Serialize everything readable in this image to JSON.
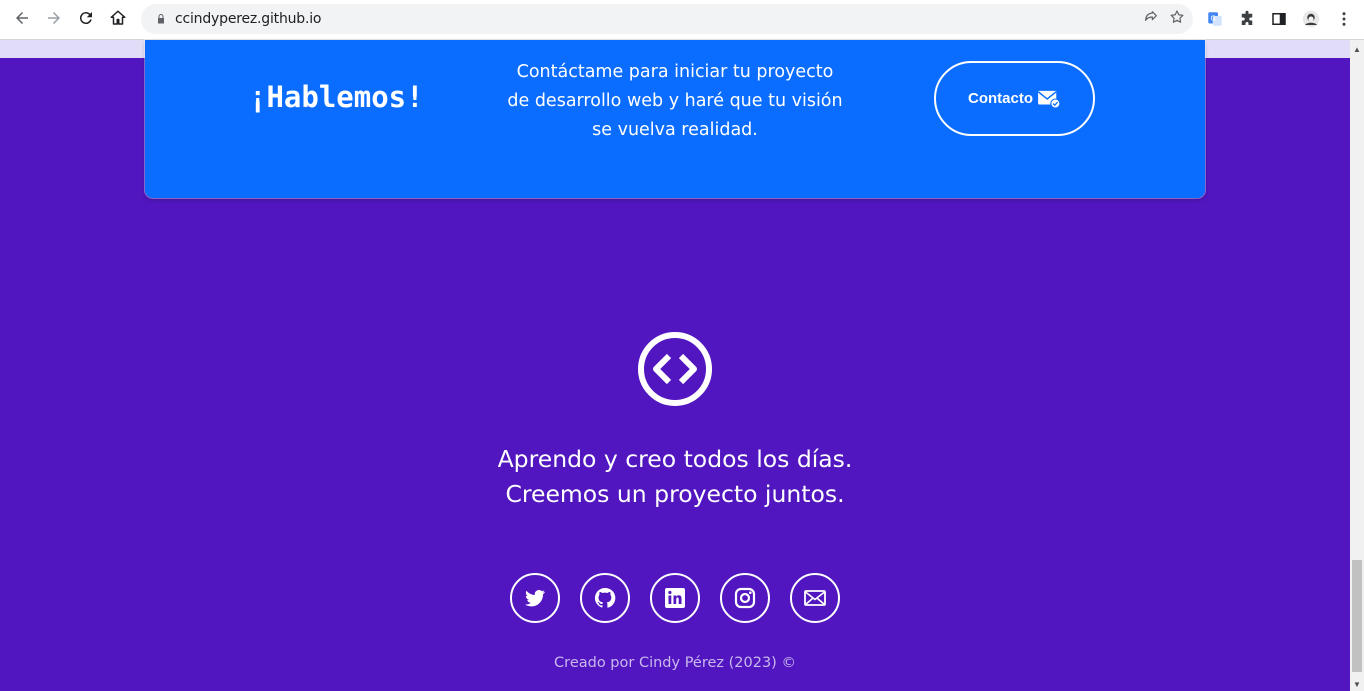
{
  "browser": {
    "url": "ccindyperez.github.io"
  },
  "cta": {
    "title": "¡Hablemos!",
    "text": "Contáctame para iniciar tu proyecto de desarrollo web y haré que tu visión se vuelva realidad.",
    "button_label": "Contacto"
  },
  "footer": {
    "tagline_line1": "Aprendo y creo todos los días.",
    "tagline_line2": "Creemos un proyecto juntos.",
    "socials": [
      "twitter-icon",
      "github-icon",
      "linkedin-icon",
      "instagram-icon",
      "email-icon"
    ],
    "credit": "Creado por Cindy Pérez (2023) ©"
  },
  "colors": {
    "page_bg": "#5116bf",
    "card_bg": "#0a6dff",
    "strip_bg": "#e1dcf7"
  }
}
